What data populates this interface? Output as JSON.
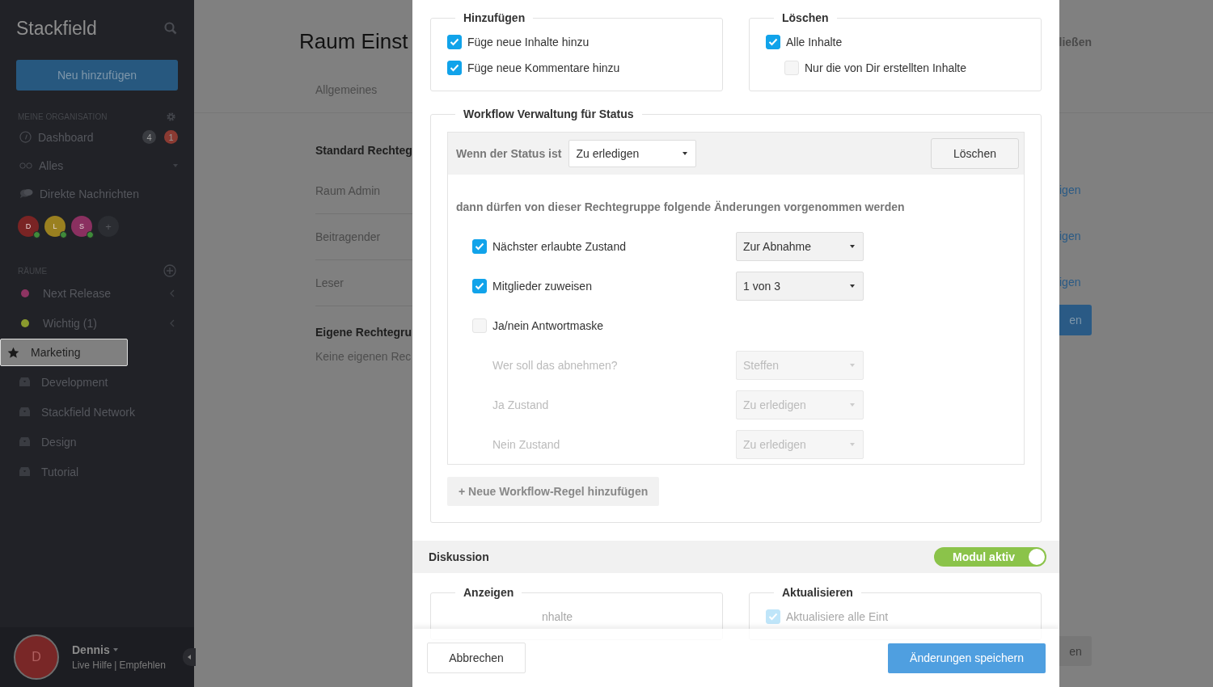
{
  "sidebar": {
    "logo": "Stackfield",
    "new_button": "Neu hinzufügen",
    "org_heading": "MEINE ORGANISATION",
    "org_items": [
      {
        "kind": "dashboard",
        "label": "Dashboard",
        "badges": [
          {
            "text": "4",
            "color": "#3a3c41"
          },
          {
            "text": "1",
            "color": "#8a3a32"
          }
        ]
      },
      {
        "kind": "all",
        "label": "Alles"
      },
      {
        "kind": "chat",
        "label": "Direkte Nachrichten"
      }
    ],
    "contacts": [
      {
        "initial": "D",
        "color": "#7a2424"
      },
      {
        "initial": "L",
        "color": "#9a8020"
      },
      {
        "initial": "S",
        "color": "#8a3060"
      }
    ],
    "add_contact": "+",
    "rooms_heading": "RÄUME",
    "rooms": [
      {
        "kind": "dot",
        "label": "Next Release",
        "color": "#8e3462",
        "selected": false
      },
      {
        "kind": "dot",
        "label": "Wichtig (1)",
        "color": "#8a9a2e",
        "selected": false
      },
      {
        "kind": "star",
        "label": "Marketing",
        "selected": true
      },
      {
        "kind": "inbox",
        "label": "Development",
        "selected": false
      },
      {
        "kind": "inbox",
        "label": "Stackfield Network",
        "selected": false
      },
      {
        "kind": "inbox",
        "label": "Design",
        "selected": false
      },
      {
        "kind": "inbox",
        "label": "Tutorial",
        "selected": false
      }
    ],
    "user": {
      "initial": "D",
      "name": "Dennis",
      "links": [
        "Live Hilfe",
        "Empfehlen"
      ],
      "separator": "|"
    }
  },
  "page": {
    "title": "Raum Einst",
    "close": "ließen",
    "tabs": [
      "Allgemeines"
    ],
    "standard_heading": "Standard Rechteg",
    "groups": [
      {
        "name": "Raum Admin",
        "link": "igen"
      },
      {
        "name": "Beitragender",
        "link": "igen"
      },
      {
        "name": "Leser",
        "link": "igen"
      }
    ],
    "add_button": "en",
    "own_heading": "Eigene Rechtegru",
    "own_empty": "Keine eigenen Rec",
    "bottom_button": "en"
  },
  "modal": {
    "permissions": [
      {
        "legend": "Hinzufügen",
        "options": [
          {
            "label": "Füge neue Inhalte hinzu",
            "checked": true
          },
          {
            "label": "Füge neue Kommentare hinzu",
            "checked": true
          }
        ]
      },
      {
        "legend": "Löschen",
        "options": [
          {
            "label": "Alle Inhalte",
            "checked": true,
            "children": [
              {
                "label": "Nur die von Dir erstellten Inhalte",
                "checked": false
              }
            ]
          }
        ]
      }
    ],
    "workflow": {
      "legend": "Workflow Verwaltung für Status",
      "condition_label": "Wenn der Status ist",
      "status": "Zu erledigen",
      "delete_button": "Löschen",
      "description": "dann dürfen von dieser Rechtegruppe folgende Änderungen vorgenommen werden",
      "rows": [
        {
          "kind": "checkbox",
          "label": "Nächster erlaubte Zustand",
          "checked": true,
          "value": "Zur Abnahme",
          "disabled": false
        },
        {
          "kind": "checkbox",
          "label": "Mitglieder zuweisen",
          "checked": true,
          "value": "1 von 3",
          "disabled": false
        },
        {
          "kind": "checkbox",
          "label": "Ja/nein Antwortmaske",
          "checked": false,
          "disabled": false
        },
        {
          "kind": "select",
          "label": "Wer soll das abnehmen?",
          "value": "Steffen",
          "disabled": true
        },
        {
          "kind": "select",
          "label": "Ja Zustand",
          "value": "Zu erledigen",
          "disabled": true
        },
        {
          "kind": "select",
          "label": "Nein Zustand",
          "value": "Zu erledigen",
          "disabled": true
        }
      ],
      "add_rule": "+ Neue Workflow-Regel hinzufügen"
    },
    "discussion": {
      "title": "Diskussion",
      "toggle": {
        "label": "Modul aktiv",
        "on": true
      },
      "groups": [
        {
          "legend": "Anzeigen",
          "options": [
            {
              "label": "nhalte",
              "kind": "covered"
            }
          ]
        },
        {
          "legend": "Aktualisieren",
          "options": [
            {
              "label": "Aktualisiere alle Eint",
              "checked": true,
              "kind": "plain"
            }
          ]
        }
      ]
    },
    "cancel_button": "Abbrechen",
    "save_button": "Änderungen speichern"
  }
}
